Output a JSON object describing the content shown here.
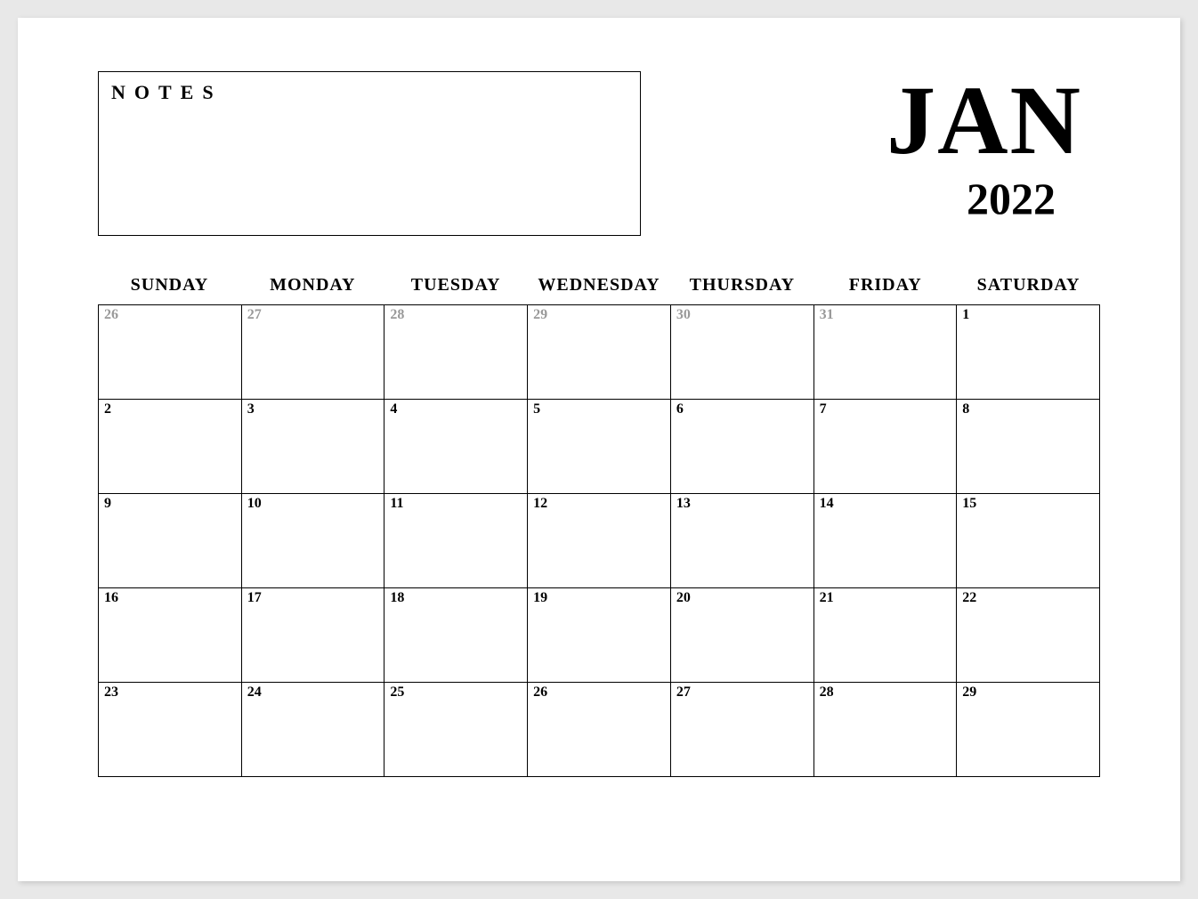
{
  "notes_label": "NOTES",
  "month": "JAN",
  "year": "2022",
  "weekdays": [
    "SUNDAY",
    "MONDAY",
    "TUESDAY",
    "WEDNESDAY",
    "THURSDAY",
    "FRIDAY",
    "SATURDAY"
  ],
  "days": [
    {
      "n": "26",
      "other": true
    },
    {
      "n": "27",
      "other": true
    },
    {
      "n": "28",
      "other": true
    },
    {
      "n": "29",
      "other": true
    },
    {
      "n": "30",
      "other": true
    },
    {
      "n": "31",
      "other": true
    },
    {
      "n": "1",
      "other": false
    },
    {
      "n": "2",
      "other": false
    },
    {
      "n": "3",
      "other": false
    },
    {
      "n": "4",
      "other": false
    },
    {
      "n": "5",
      "other": false
    },
    {
      "n": "6",
      "other": false
    },
    {
      "n": "7",
      "other": false
    },
    {
      "n": "8",
      "other": false
    },
    {
      "n": "9",
      "other": false
    },
    {
      "n": "10",
      "other": false
    },
    {
      "n": "11",
      "other": false
    },
    {
      "n": "12",
      "other": false
    },
    {
      "n": "13",
      "other": false
    },
    {
      "n": "14",
      "other": false
    },
    {
      "n": "15",
      "other": false
    },
    {
      "n": "16",
      "other": false
    },
    {
      "n": "17",
      "other": false
    },
    {
      "n": "18",
      "other": false
    },
    {
      "n": "19",
      "other": false
    },
    {
      "n": "20",
      "other": false
    },
    {
      "n": "21",
      "other": false
    },
    {
      "n": "22",
      "other": false
    },
    {
      "n": "23",
      "other": false
    },
    {
      "n": "24",
      "other": false
    },
    {
      "n": "25",
      "other": false
    },
    {
      "n": "26",
      "other": false
    },
    {
      "n": "27",
      "other": false
    },
    {
      "n": "28",
      "other": false
    },
    {
      "n": "29",
      "other": false
    }
  ]
}
